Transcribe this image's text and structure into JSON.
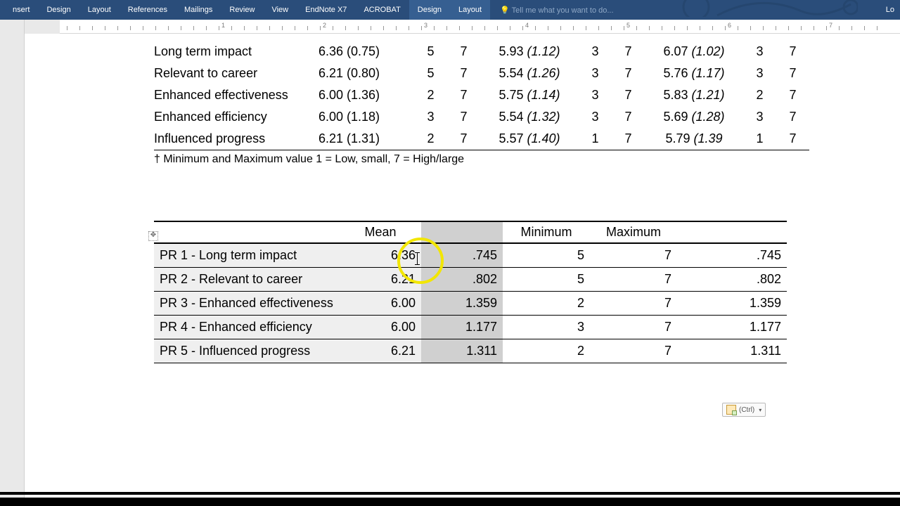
{
  "ribbon": {
    "tabs": [
      "nsert",
      "Design",
      "Layout",
      "References",
      "Mailings",
      "Review",
      "View",
      "EndNote X7",
      "ACROBAT",
      "Design",
      "Layout"
    ],
    "active_indices": [
      9,
      10
    ],
    "tell_me": "Tell me what you want to do...",
    "right_label": "Lo"
  },
  "ruler": {
    "numbers": [
      1,
      2,
      3,
      4,
      5,
      6,
      7
    ]
  },
  "upper_table": {
    "rows": [
      {
        "label": "Long term impact",
        "m1": "6.36 (0.75)",
        "a": "5",
        "b": "7",
        "m2": "5.93",
        "m2i": "(1.12)",
        "c": "3",
        "d": "7",
        "m3": "6.07",
        "m3i": "(1.02)",
        "e": "3",
        "f": "7"
      },
      {
        "label": "Relevant to career",
        "m1": "6.21 (0.80)",
        "a": "5",
        "b": "7",
        "m2": "5.54",
        "m2i": "(1.26)",
        "c": "3",
        "d": "7",
        "m3": "5.76",
        "m3i": "(1.17)",
        "e": "3",
        "f": "7"
      },
      {
        "label": "Enhanced effectiveness",
        "m1": "6.00 (1.36)",
        "a": "2",
        "b": "7",
        "m2": "5.75",
        "m2i": "(1.14)",
        "c": "3",
        "d": "7",
        "m3": "5.83",
        "m3i": "(1.21)",
        "e": "2",
        "f": "7"
      },
      {
        "label": "Enhanced efficiency",
        "m1": "6.00 (1.18)",
        "a": "3",
        "b": "7",
        "m2": "5.54",
        "m2i": "(1.32)",
        "c": "3",
        "d": "7",
        "m3": "5.69",
        "m3i": "(1.28)",
        "e": "3",
        "f": "7"
      },
      {
        "label": "Influenced progress",
        "m1": "6.21 (1.31)",
        "a": "2",
        "b": "7",
        "m2": "5.57",
        "m2i": "(1.40)",
        "c": "1",
        "d": "7",
        "m3": "5.79",
        "m3i": "(1.39",
        "e": "1",
        "f": "7"
      }
    ],
    "footnote": "† Minimum and Maximum value 1 = Low, small, 7 = High/large"
  },
  "lower_table": {
    "headers": [
      "",
      "Mean",
      "",
      "Minimum",
      "Maximum",
      ""
    ],
    "rows": [
      {
        "label": "PR 1 - Long term impact",
        "mean": "6.36",
        "col2": ".745",
        "min": "5",
        "max": "7",
        "last": ".745"
      },
      {
        "label": "PR 2 - Relevant to career",
        "mean": "6.21",
        "col2": ".802",
        "min": "5",
        "max": "7",
        "last": ".802"
      },
      {
        "label": "PR 3 - Enhanced effectiveness",
        "mean": "6.00",
        "col2": "1.359",
        "min": "2",
        "max": "7",
        "last": "1.359"
      },
      {
        "label": "PR 4 - Enhanced efficiency",
        "mean": "6.00",
        "col2": "1.177",
        "min": "3",
        "max": "7",
        "last": "1.177"
      },
      {
        "label": "PR 5 - Influenced progress",
        "mean": "6.21",
        "col2": "1.311",
        "min": "2",
        "max": "7",
        "last": "1.311"
      }
    ]
  },
  "paste_options": {
    "label": "(Ctrl)"
  }
}
